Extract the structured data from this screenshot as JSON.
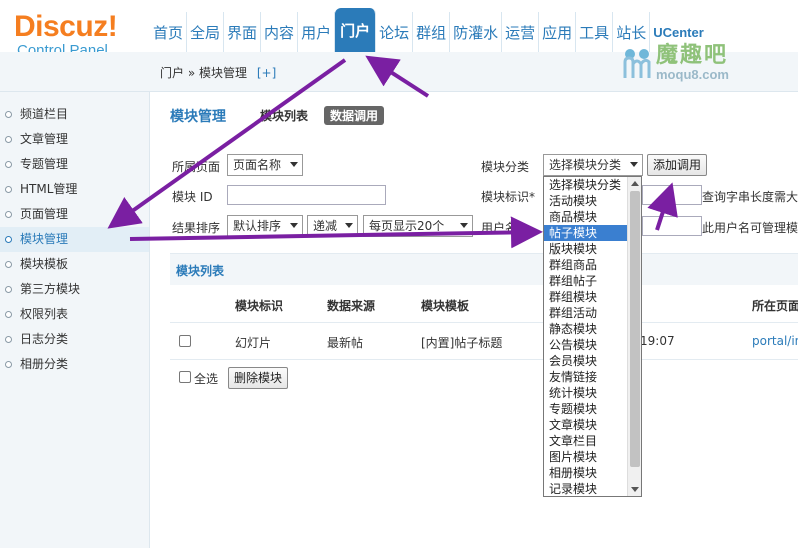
{
  "logo": {
    "main": "Discuz!",
    "sub": "Control Panel"
  },
  "nav": {
    "items": [
      {
        "label": "首页"
      },
      {
        "label": "全局"
      },
      {
        "label": "界面"
      },
      {
        "label": "内容"
      },
      {
        "label": "用户"
      },
      {
        "label": "门户"
      },
      {
        "label": "论坛"
      },
      {
        "label": "群组"
      },
      {
        "label": "防灌水"
      },
      {
        "label": "运营"
      },
      {
        "label": "应用"
      },
      {
        "label": "工具"
      },
      {
        "label": "站长"
      },
      {
        "label": "UCenter"
      }
    ],
    "active": "门户"
  },
  "watermark": {
    "title": "魔趣吧",
    "url": "moqu8.com"
  },
  "breadcrumb": {
    "section": "门户",
    "separator": "»",
    "page": "模块管理",
    "add": "[+]"
  },
  "sidebar": {
    "items": [
      {
        "label": "频道栏目"
      },
      {
        "label": "文章管理"
      },
      {
        "label": "专题管理"
      },
      {
        "label": "HTML管理"
      },
      {
        "label": "页面管理"
      },
      {
        "label": "模块管理"
      },
      {
        "label": "模块模板"
      },
      {
        "label": "第三方模块"
      },
      {
        "label": "权限列表"
      },
      {
        "label": "日志分类"
      },
      {
        "label": "相册分类"
      }
    ],
    "active": "模块管理"
  },
  "main": {
    "title": "模块管理",
    "tabs": [
      {
        "label": "模块列表"
      },
      {
        "label": "数据调用"
      }
    ],
    "active_tab": "数据调用"
  },
  "form": {
    "page_label": "所属页面",
    "page_select": "页面名称",
    "block_id_label": "模块 ID",
    "sort_label": "结果排序",
    "sort_select": "默认排序",
    "order_select": "递减",
    "perpage_select": "每页显示20个",
    "category_label": "模块分类",
    "category_select": "选择模块分类",
    "add_button": "添加调用",
    "mark_label": "模块标识*",
    "mark_hint": "查询字串长度需大",
    "username_label": "用户名",
    "username_hint": "此用户名可管理模"
  },
  "list": {
    "title": "模块列表",
    "headers": {
      "mark": "模块标识",
      "source": "数据来源",
      "template": "模块模板",
      "page": "所在页面"
    },
    "rows": [
      {
        "mark": "幻灯片",
        "source": "最新帖",
        "template": "[内置]帖子标题",
        "time": "19:07",
        "page": "portal/in"
      }
    ],
    "select_all": "全选",
    "delete_button": "删除模块"
  },
  "dropdown": {
    "selected": "帖子模块",
    "options": [
      "选择模块分类",
      "活动模块",
      "商品模块",
      "帖子模块",
      "版块模块",
      "群组商品",
      "群组帖子",
      "群组模块",
      "群组活动",
      "静态模块",
      "公告模块",
      "会员模块",
      "友情链接",
      "统计模块",
      "专题模块",
      "文章模块",
      "文章栏目",
      "图片模块",
      "相册模块",
      "记录模块"
    ]
  },
  "colors": {
    "accent": "#2b7bb9",
    "logo": "#f57e20",
    "arrow": "#7a1fa2",
    "highlight": "#3a7fd0"
  }
}
